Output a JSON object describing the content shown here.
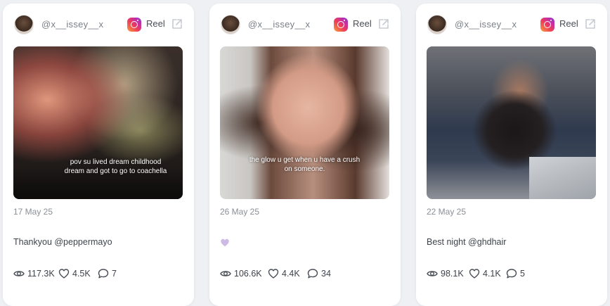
{
  "posts": [
    {
      "username": "@x__issey__x",
      "type_label": "Reel",
      "thumbnail_caption": "pov su lived dream childhood dream and got to go to coachella",
      "date": "17 May 25",
      "text": "Thankyou @peppermayo",
      "views": "117.3K",
      "likes": "4.5K",
      "comments": "7"
    },
    {
      "username": "@x__issey__x",
      "type_label": "Reel",
      "thumbnail_caption": "the glow u get when u have a crush on someone.",
      "date": "26 May 25",
      "text": "",
      "text_emoji": "purple-heart",
      "views": "106.6K",
      "likes": "4.4K",
      "comments": "34"
    },
    {
      "username": "@x__issey__x",
      "type_label": "Reel",
      "thumbnail_caption": "",
      "date": "22 May 25",
      "text": "Best night @ghdhair",
      "views": "98.1K",
      "likes": "4.1K",
      "comments": "5"
    }
  ],
  "icons": {
    "platform": "instagram-icon",
    "external_link": "external-link-icon",
    "views": "eye-icon",
    "likes": "heart-icon",
    "comments": "comment-icon"
  },
  "colors": {
    "background": "#eef0f3",
    "card": "#ffffff",
    "muted_text": "#8a8f96",
    "body_text": "#3e434b"
  }
}
